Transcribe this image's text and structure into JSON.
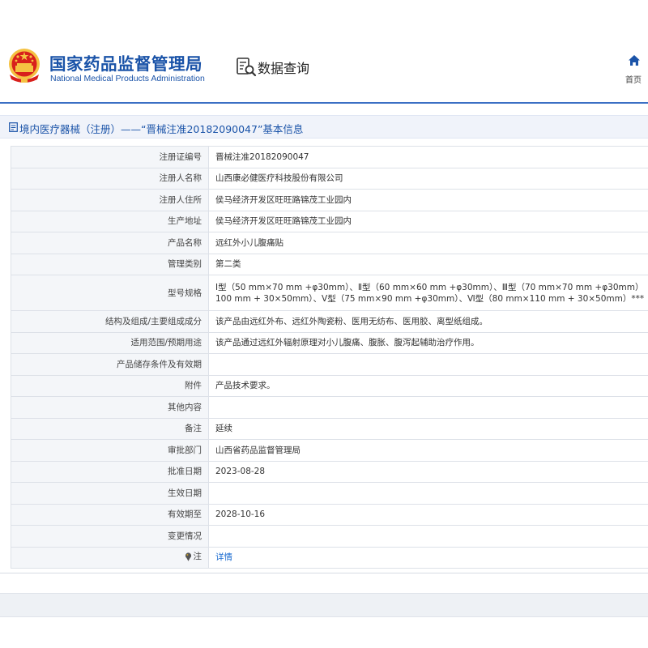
{
  "header": {
    "logo_cn": "国家药品监督管理局",
    "logo_en": "National Medical Products Administration",
    "emblem_icon": "national-emblem-icon",
    "data_query_label": "数据查询",
    "data_query_icon": "search-document-icon",
    "home_label": "首页",
    "home_icon": "home-icon"
  },
  "page_title": "境内医疗器械（注册）——“晋械注准20182090047”基本信息",
  "title_icon": "document-icon",
  "colors": {
    "brand_blue": "#1a53a8",
    "link_blue": "#1a6bd0",
    "label_bg": "#f4f6f9",
    "border": "#dde1e8",
    "rule": "#3b6fc4"
  },
  "rows": [
    {
      "label": "注册证编号",
      "value": "晋械注准20182090047"
    },
    {
      "label": "注册人名称",
      "value": "山西康必健医疗科技股份有限公司"
    },
    {
      "label": "注册人住所",
      "value": "侯马经济开发区旺旺路锦茂工业园内"
    },
    {
      "label": "生产地址",
      "value": "侯马经济开发区旺旺路锦茂工业园内"
    },
    {
      "label": "产品名称",
      "value": "远红外小儿腹痛贴"
    },
    {
      "label": "管理类别",
      "value": "第二类"
    },
    {
      "label": "型号规格",
      "value_line1": "Ⅰ型（50 mm×70 mm +φ30mm）、Ⅱ型（60 mm×60 mm +φ30mm）、Ⅲ型（70 mm×70 mm +φ30mm）",
      "value_line2": "100 mm + 30×50mm）、Ⅴ型（75 mm×90 mm +φ30mm）、Ⅵ型（80 mm×110 mm + 30×50mm）***"
    },
    {
      "label": "结构及组成/主要组成成分",
      "value": "该产品由远红外布、远红外陶瓷粉、医用无纺布、医用胶、离型纸组成。"
    },
    {
      "label": "适用范围/预期用途",
      "value": "该产品通过远红外辐射原理对小儿腹痛、腹胀、腹泻起辅助治疗作用。"
    },
    {
      "label": "产品储存条件及有效期",
      "value": ""
    },
    {
      "label": "附件",
      "value": "产品技术要求。"
    },
    {
      "label": "其他内容",
      "value": ""
    },
    {
      "label": "备注",
      "value": "延续"
    },
    {
      "label": "审批部门",
      "value": "山西省药品监督管理局"
    },
    {
      "label": "批准日期",
      "value": "2023-08-28"
    },
    {
      "label": "生效日期",
      "value": ""
    },
    {
      "label": "有效期至",
      "value": "2028-10-16"
    },
    {
      "label": "变更情况",
      "value": ""
    },
    {
      "label": "注",
      "label_icon": "pin-icon",
      "value": "详情"
    }
  ]
}
